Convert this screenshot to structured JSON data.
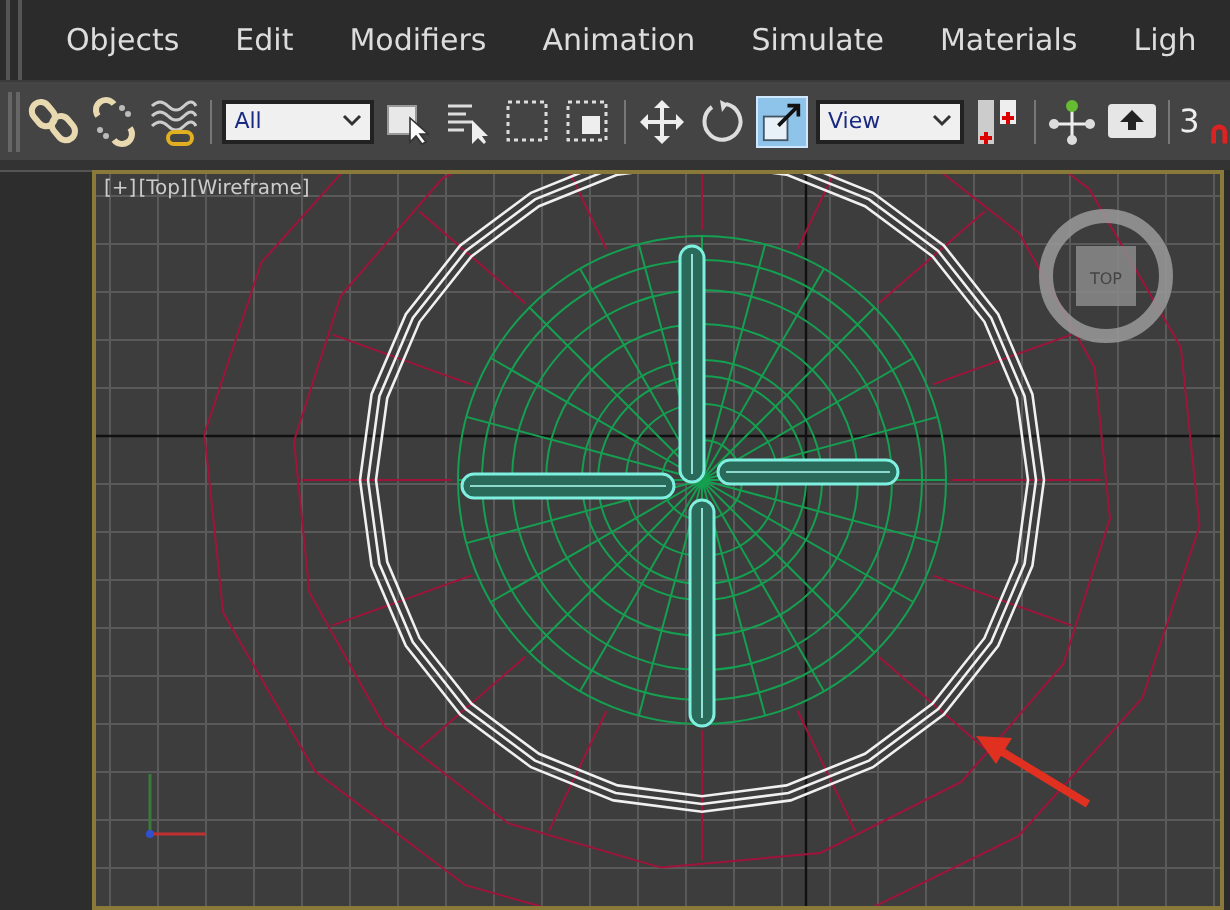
{
  "menu": [
    "Objects",
    "Edit",
    "Modifiers",
    "Animation",
    "Simulate",
    "Materials",
    "Ligh"
  ],
  "toolbar": {
    "selection_filter": "All",
    "reference_coord": "View",
    "snap_count": "3",
    "scale_tool": {
      "selected": true
    }
  },
  "viewport": {
    "labels": [
      "[+]",
      "[Top]",
      "[Wireframe]"
    ],
    "viewcube_label": "TOP"
  }
}
